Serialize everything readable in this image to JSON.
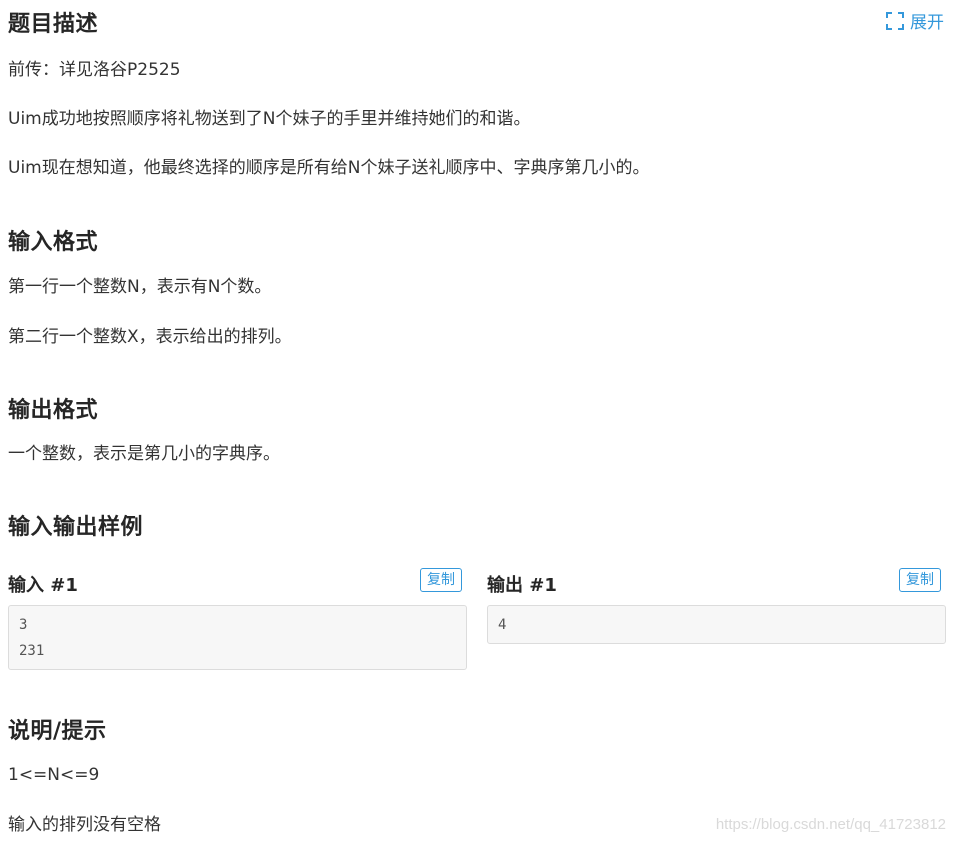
{
  "expand": {
    "label": "展开"
  },
  "description": {
    "title": "题目描述",
    "lines": [
      "前传：详见洛谷P2525",
      "Uim成功地按照顺序将礼物送到了N个妹子的手里并维持她们的和谐。",
      "Uim现在想知道，他最终选择的顺序是所有给N个妹子送礼顺序中、字典序第几小的。"
    ]
  },
  "input_format": {
    "title": "输入格式",
    "lines": [
      "第一行一个整数N，表示有N个数。",
      "第二行一个整数X，表示给出的排列。"
    ]
  },
  "output_format": {
    "title": "输出格式",
    "lines": [
      "一个整数，表示是第几小的字典序。"
    ]
  },
  "samples": {
    "title": "输入输出样例",
    "input": {
      "label": "输入 #1",
      "copy": "复制",
      "lines": [
        "3",
        "231"
      ]
    },
    "output": {
      "label": "输出 #1",
      "copy": "复制",
      "lines": [
        "4"
      ]
    }
  },
  "hint": {
    "title": "说明/提示",
    "lines": [
      "1<=N<=9",
      "输入的排列没有空格"
    ]
  },
  "watermark": "https://blog.csdn.net/qq_41723812"
}
